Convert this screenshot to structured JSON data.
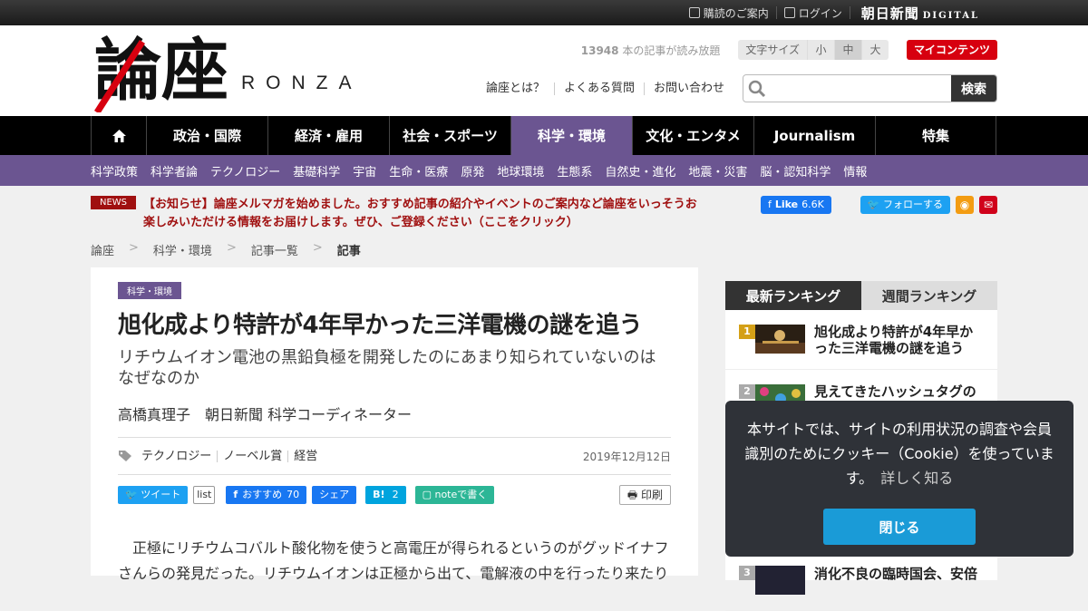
{
  "topbar": {
    "subscribe": "購読のご案内",
    "login": "ログイン",
    "asahi_logo": "朝日新聞",
    "asahi_sub": "DIGITAL"
  },
  "header": {
    "logo_kanji": "論座",
    "logo_roman": "RONZA",
    "read_count": "13948",
    "read_text": "本の記事が読み放題",
    "fontsize_label": "文字サイズ",
    "fontsizes": [
      "小",
      "中",
      "大"
    ],
    "my_contents": "マイコンテンツ",
    "links": [
      "論座とは？",
      "よくある質問",
      "お問い合わせ"
    ],
    "search_placeholder": "",
    "search_button": "検索"
  },
  "nav": {
    "home_icon": "home-icon",
    "items": [
      "政治・国際",
      "経済・雇用",
      "社会・スポーツ",
      "科学・環境",
      "文化・エンタメ",
      "Journalism",
      "特集"
    ],
    "active_index": 3
  },
  "subnav": [
    "科学政策",
    "科学者論",
    "テクノロジー",
    "基礎科学",
    "宇宙",
    "生命・医療",
    "原発",
    "地球環境",
    "生態系",
    "自然史・進化",
    "地震・災害",
    "脳・認知科学",
    "情報"
  ],
  "news": {
    "badge": "NEWS",
    "text": "【お知らせ】論座メルマガを始めました。おすすめ記事の紹介やイベントのご案内など論座をいっそうお楽しみいただける情報をお届けします。ぜひ、ご登録ください（ここをクリック）"
  },
  "social": {
    "fb_like": "Like",
    "fb_count": "6.6K",
    "tw_follow": "フォローする"
  },
  "breadcrumb": [
    "論座",
    "科学・環境",
    "記事一覧",
    "記事"
  ],
  "article": {
    "category": "科学・環境",
    "title": "旭化成より特許が4年早かった三洋電機の謎を追う",
    "subtitle": "リチウムイオン電池の黒鉛負極を開発したのにあまり知られていないのはなぜなのか",
    "author": "高橋真理子　朝日新聞 科学コーディネーター",
    "tags": [
      "テクノロジー",
      "ノーベル賞",
      "経営"
    ],
    "date": "2019年12月12日",
    "share": {
      "tweet": "ツイート",
      "list": "list",
      "fb_recommend": "おすすめ",
      "fb_count": "70",
      "fb_share": "シェア",
      "hatena": "B!",
      "hatena_count": "2",
      "note": "noteで書く",
      "print": "印刷"
    },
    "body": "正極にリチウムコバルト酸化物を使うと高電圧が得られるというのがグッドイナフさんらの発見だった。リチウムイオンは正極から出て、電解液の中を行ったり来たり"
  },
  "ranking": {
    "tab_latest": "最新ランキング",
    "tab_weekly": "週間ランキング",
    "items": [
      {
        "rank": "1",
        "title": "旭化成より特許が4年早かった三洋電機の謎を追う"
      },
      {
        "rank": "2",
        "title": "見えてきたハッシュタグの"
      },
      {
        "rank": "3",
        "title": "消化不良の臨時国会、安倍"
      }
    ]
  },
  "cookie": {
    "text": "本サイトでは、サイトの利用状況の調査や会員識別のためにクッキー（Cookie）を使っています。",
    "more": "詳しく知る",
    "close": "閉じる"
  },
  "colors": {
    "accent_purple": "#6b5591",
    "news_red": "#a01010",
    "my_contents_red": "#d7000f",
    "cookie_button": "#1a9bd7"
  }
}
